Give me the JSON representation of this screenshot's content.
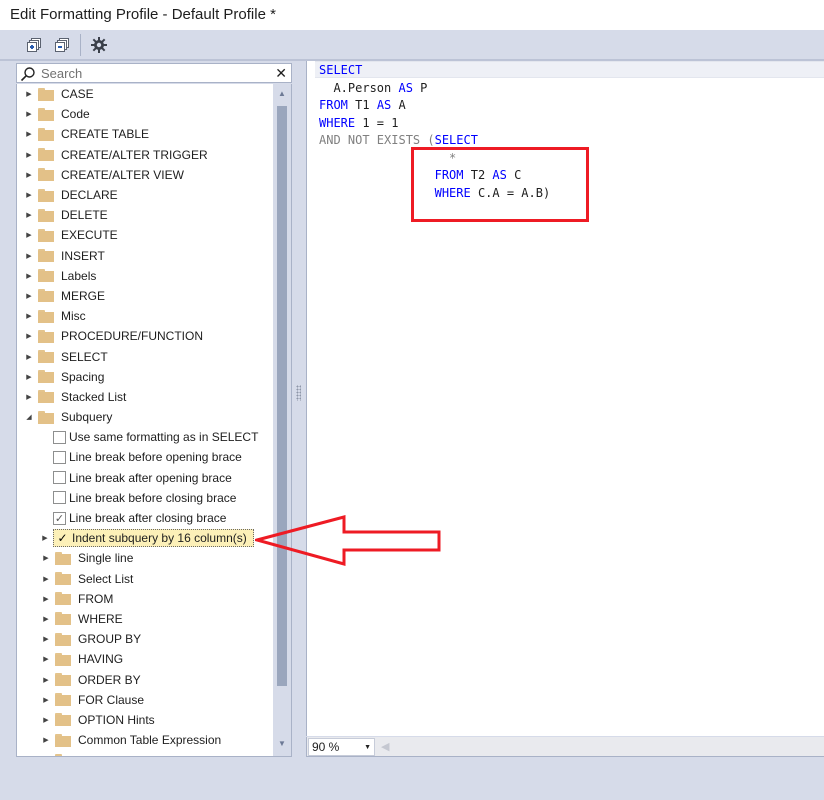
{
  "window": {
    "title": "Edit Formatting Profile - Default Profile *"
  },
  "toolbar": {
    "expand_all": "expand-all",
    "collapse_all": "collapse-all",
    "settings": "settings"
  },
  "search": {
    "placeholder": "Search",
    "value": "",
    "clear_label": "✕"
  },
  "tree": {
    "top_items": [
      "CASE",
      "Code",
      "CREATE TABLE",
      "CREATE/ALTER TRIGGER",
      "CREATE/ALTER VIEW",
      "DECLARE",
      "DELETE",
      "EXECUTE",
      "INSERT",
      "Labels",
      "MERGE",
      "Misc",
      "PROCEDURE/FUNCTION",
      "SELECT",
      "Spacing",
      "Stacked List"
    ],
    "expanded": {
      "label": "Subquery",
      "options": [
        {
          "label": "Use same formatting as in SELECT",
          "checked": false
        },
        {
          "label": "Line break before opening brace",
          "checked": false
        },
        {
          "label": "Line break after opening brace",
          "checked": false
        },
        {
          "label": "Line break before closing brace",
          "checked": false
        },
        {
          "label": "Line break after closing brace",
          "checked": true
        }
      ],
      "selected_option": {
        "label": "Indent subquery by 16 column(s)",
        "checked": true
      },
      "subfolders": [
        "Single line",
        "Select List",
        "FROM",
        "WHERE",
        "GROUP BY",
        "HAVING",
        "ORDER BY",
        "FOR Clause",
        "OPTION Hints",
        "Common Table Expression"
      ]
    }
  },
  "editor": {
    "lines": [
      [
        {
          "t": "SELECT",
          "c": "kw"
        }
      ],
      [
        {
          "t": "  A.Person ",
          "c": "id"
        },
        {
          "t": "AS",
          "c": "kw"
        },
        {
          "t": " P",
          "c": "id"
        }
      ],
      [
        {
          "t": "FROM",
          "c": "kw"
        },
        {
          "t": " T1 ",
          "c": "id"
        },
        {
          "t": "AS",
          "c": "kw"
        },
        {
          "t": " A",
          "c": "id"
        }
      ],
      [
        {
          "t": "WHERE",
          "c": "kw"
        },
        {
          "t": " 1 = 1",
          "c": "id"
        }
      ],
      [
        {
          "t": "AND NOT EXISTS (",
          "c": "gray"
        },
        {
          "t": "SELECT",
          "c": "kw"
        }
      ],
      [
        {
          "t": "                  *",
          "c": "gray"
        }
      ],
      [
        {
          "t": "                FROM",
          "c": "kw"
        },
        {
          "t": " T2 ",
          "c": "id"
        },
        {
          "t": "AS",
          "c": "kw"
        },
        {
          "t": " C",
          "c": "id"
        }
      ],
      [
        {
          "t": "                WHERE",
          "c": "kw"
        },
        {
          "t": " C.A = A.B)",
          "c": "id"
        }
      ]
    ]
  },
  "statusbar": {
    "zoom": "90 %"
  },
  "annotations": {
    "highlight_color": "#ee1b24"
  }
}
